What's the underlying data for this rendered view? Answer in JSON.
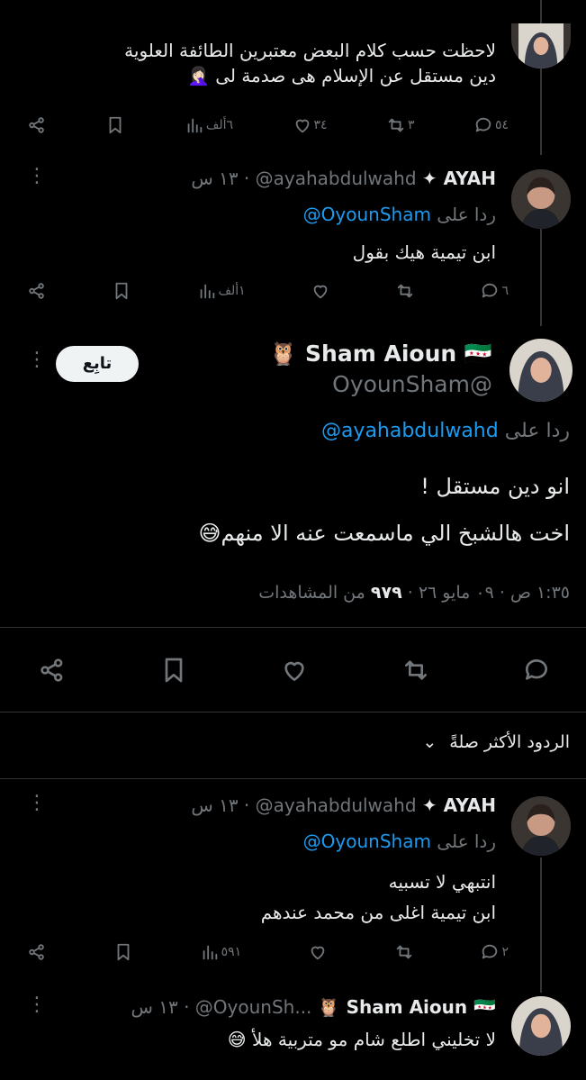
{
  "tweet1": {
    "lines": [
      "لاحظت حسب كلام البعض معتبرين الطائفة العلوية",
      "دين مستقل عن الإسلام  هى صدمة لى 🤦🏻‍♀️"
    ],
    "replies": "٥٤",
    "reposts": "٣",
    "likes": "٣٤",
    "views": "٦ألف"
  },
  "tweet2": {
    "name": "AYAH ✦",
    "handle": "@ayahabdulwahd",
    "time": "١٣ س",
    "reply_prefix": "ردا على",
    "reply_to": "@OyounSham",
    "text": "ابن تيمية هيك بقول",
    "replies": "٦",
    "reposts": "",
    "likes": "",
    "views": "١ألف"
  },
  "main_tweet": {
    "name": "Sham Aioun 🇸🇾 🦉",
    "handle": "@OyounSham",
    "follow_label": "تابِع",
    "reply_prefix": "ردا على",
    "reply_to": "@ayahabdulwahd",
    "lines": [
      "انو دين مستقل !",
      "اخت هالشبخ الي ماسمعت عنه الا منهم😅"
    ],
    "time": "١:٣٥ ص",
    "date": "٠٩ مايو ٢٦",
    "views_count": "٩٧٩",
    "views_label": "من المشاهدات"
  },
  "sort": {
    "label": "الردود الأكثر صلةً"
  },
  "reply1": {
    "name": "AYAH ✦",
    "handle": "@ayahabdulwahd",
    "time": "١٣ س",
    "reply_prefix": "ردا على",
    "reply_to": "@OyounSham",
    "lines": [
      "انتبهي لا تسبيه",
      "ابن تيمية اغلى من محمد عندهم"
    ],
    "replies": "٢",
    "reposts": "",
    "likes": "",
    "views": "٥٩١"
  },
  "reply2": {
    "name": "Sham Aioun 🇸🇾 🦉",
    "handle": "@OyounSh...",
    "time": "١٣ س",
    "text": "لا تخليني اطلع شام مو متربية هلأ 😅"
  },
  "colors": {
    "background": "#000000",
    "link": "#1d9bf0",
    "muted": "#71767b",
    "text": "#e7e9ea"
  }
}
